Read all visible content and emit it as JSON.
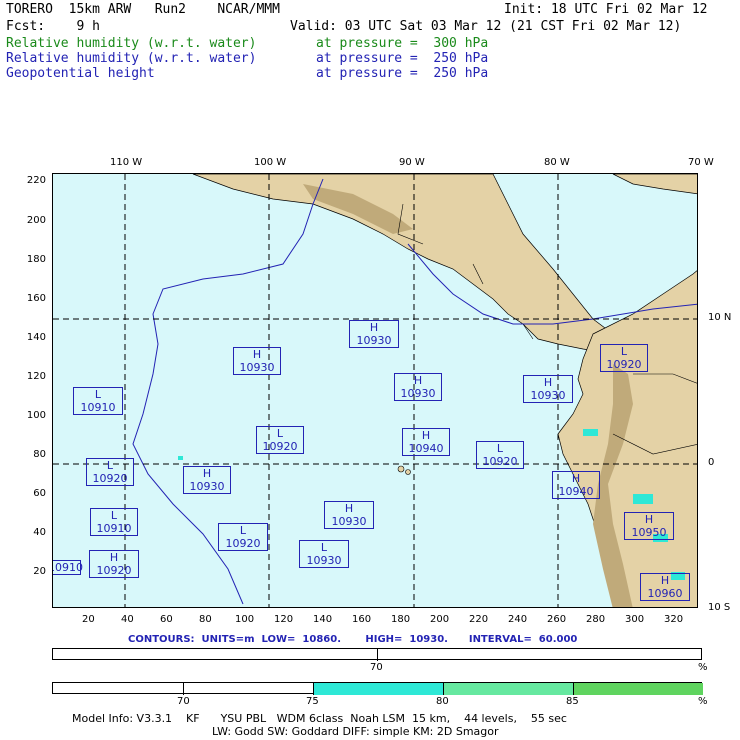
{
  "header": {
    "line1_left": "TORERO  15km ARW   Run2    NCAR/MMM",
    "line1_right": "Init: 18 UTC Fri 02 Mar 12",
    "line2_left": "Fcst:    9 h",
    "line2_right": "Valid: 03 UTC Sat 03 Mar 12 (21 CST Fri 02 Mar 12)",
    "fields": [
      {
        "name": "Relative humidity (w.r.t. water)",
        "level": "at pressure =  300 hPa",
        "color": "#1a8a1a"
      },
      {
        "name": "Relative humidity (w.r.t. water)",
        "level": "at pressure =  250 hPa",
        "color": "#2323b4"
      },
      {
        "name": "Geopotential height",
        "level": "at pressure =  250 hPa",
        "color": "#2323b4"
      }
    ]
  },
  "axes": {
    "top_lon_labels": [
      "110 W",
      "100 W",
      "90 W",
      "80 W",
      "70 W"
    ],
    "right_lat_labels": [
      "10 N",
      "0",
      "10 S"
    ],
    "y_ticks": [
      "220",
      "200",
      "180",
      "160",
      "140",
      "120",
      "100",
      "80",
      "60",
      "40",
      "20"
    ],
    "x_ticks": [
      "20",
      "40",
      "60",
      "80",
      "100",
      "120",
      "140",
      "160",
      "180",
      "200",
      "220",
      "240",
      "260",
      "280",
      "300",
      "320"
    ]
  },
  "centers": [
    {
      "type": "H",
      "value": "10930"
    },
    {
      "type": "H",
      "value": "10930"
    },
    {
      "type": "L",
      "value": "10920"
    },
    {
      "type": "H",
      "value": "10930"
    },
    {
      "type": "H",
      "value": "10930"
    },
    {
      "type": "L",
      "value": "10910"
    },
    {
      "type": "L",
      "value": "10920"
    },
    {
      "type": "H",
      "value": "10940"
    },
    {
      "type": "L",
      "value": "10920"
    },
    {
      "type": "L",
      "value": "10920"
    },
    {
      "type": "H",
      "value": "10930"
    },
    {
      "type": "H",
      "value": "10940"
    },
    {
      "type": "L",
      "value": "10910"
    },
    {
      "type": "L",
      "value": "10920"
    },
    {
      "type": "H",
      "value": "10930"
    },
    {
      "type": "H",
      "value": "10950"
    },
    {
      "type": "L",
      "value": "10930"
    },
    {
      "type": "H",
      "value": "10920"
    },
    {
      "type": "H",
      "value": "10960"
    },
    {
      "type": "",
      "value": "10910"
    }
  ],
  "contours_text": "CONTOURS:  UNITS=m  LOW=  10860.       HIGH=  10930.      INTERVAL=  60.000",
  "bar1": {
    "label": "70",
    "unit": "%"
  },
  "bar2": {
    "labels": [
      "70",
      "75",
      "80",
      "85"
    ],
    "unit": "%",
    "colors": [
      "#ffffff",
      "#ffffff",
      "#2ee8d6",
      "#66e8a0",
      "#5fd45f"
    ]
  },
  "footer": {
    "line1": "Model Info: V3.3.1    KF      YSU PBL   WDM 6class  Noah LSM  15 km,    44 levels,    55 sec",
    "line2": "LW: Godd SW: Goddard DIFF: simple KM: 2D Smagor"
  },
  "colors": {
    "ocean": "#d8f8fa",
    "land": "#e4d2a6",
    "mountain": "#c0aa7a",
    "high": "#e6e6e6",
    "contour": "#2323b4"
  }
}
